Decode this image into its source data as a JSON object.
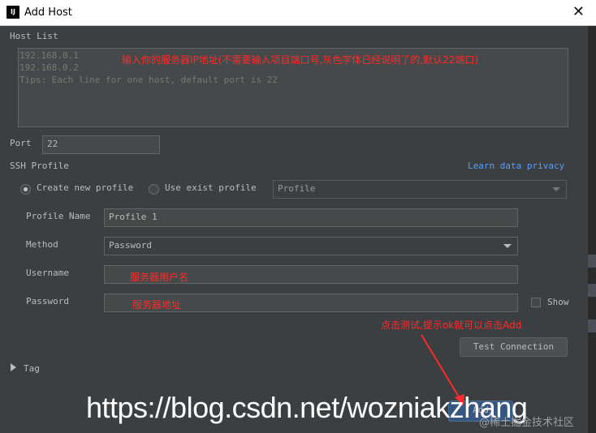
{
  "window": {
    "title": "Add Host",
    "app_icon_text": "IJ",
    "close_glyph": "✕"
  },
  "host_list": {
    "label": "Host List",
    "lines": [
      "192.168.0.1",
      "192.168.0.2",
      "Tips: Each line for one host, default port is 22"
    ],
    "annotation": "输入你的服务器IP地址(不需要输入项目端口号,灰色字体已经说明了的,默认22端口)"
  },
  "port": {
    "label": "Port",
    "value": "22"
  },
  "ssh_profile": {
    "label": "SSH Profile",
    "learn_link": "Learn data privacy",
    "radio_new": "Create new profile",
    "radio_exist": "Use exist profile",
    "profile_combo": "Profile"
  },
  "form": {
    "profile_name_label": "Profile Name",
    "profile_name_value": "Profile 1",
    "method_label": "Method",
    "method_value": "Password",
    "username_label": "Username",
    "username_annotation": "服务器用户名",
    "password_label": "Password",
    "password_annotation": "服务器地址",
    "show_label": "Show"
  },
  "test": {
    "annotation": "点击测试,提示ok就可以点击Add",
    "button": "Test Connection"
  },
  "tag": {
    "label": "Tag"
  },
  "footer": {
    "primary_button": "Add"
  },
  "watermark": {
    "url": "https://blog.csdn.net/wozniakzhang",
    "secondary": "@稀土掘金技术社区"
  },
  "colors": {
    "background": "#3c3f41",
    "field": "#45494a",
    "annotation": "#ff2a2a",
    "link": "#589df6"
  }
}
